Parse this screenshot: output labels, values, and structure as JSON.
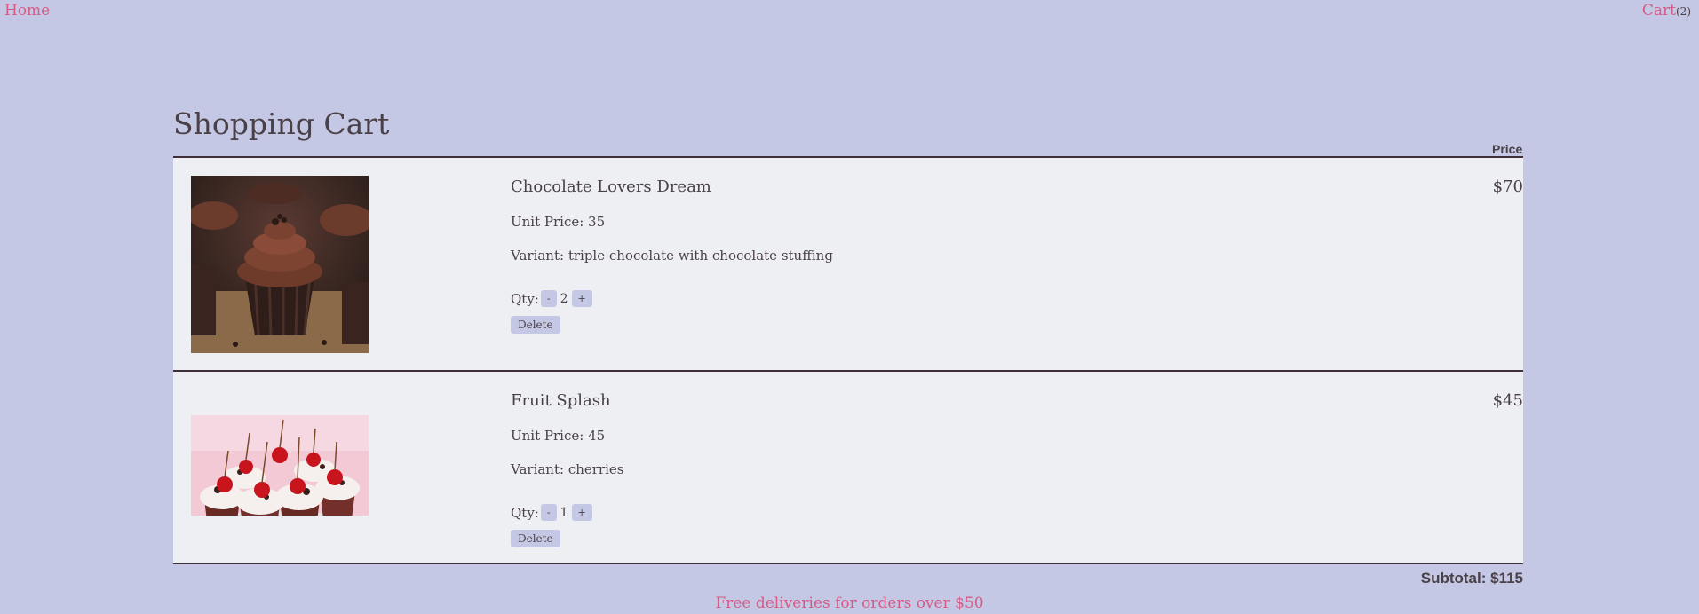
{
  "nav": {
    "home": "Home",
    "cart": "Cart",
    "cart_count": "(2)"
  },
  "page": {
    "title": "Shopping Cart",
    "price_header": "Price"
  },
  "items": [
    {
      "name": "Chocolate Lovers Dream",
      "unit_price": "Unit Price: 35",
      "variant": "Variant: triple chocolate with chocolate stuffing",
      "qty_label": "Qty:",
      "qty": "2",
      "minus": "-",
      "plus": "+",
      "delete": "Delete",
      "price": "$70",
      "image": "chocolate-cupcake-image"
    },
    {
      "name": "Fruit Splash",
      "unit_price": "Unit Price: 45",
      "variant": "Variant: cherries",
      "qty_label": "Qty:",
      "qty": "1",
      "minus": "-",
      "plus": "+",
      "delete": "Delete",
      "price": "$45",
      "image": "cherry-cupcakes-image"
    }
  ],
  "subtotal": "Subtotal: $115",
  "footer": "Free deliveries for orders over $50",
  "colors": {
    "background": "#c5c8e4",
    "panel": "#eeeff3",
    "accent": "#d65a86",
    "text": "#4a4048"
  }
}
